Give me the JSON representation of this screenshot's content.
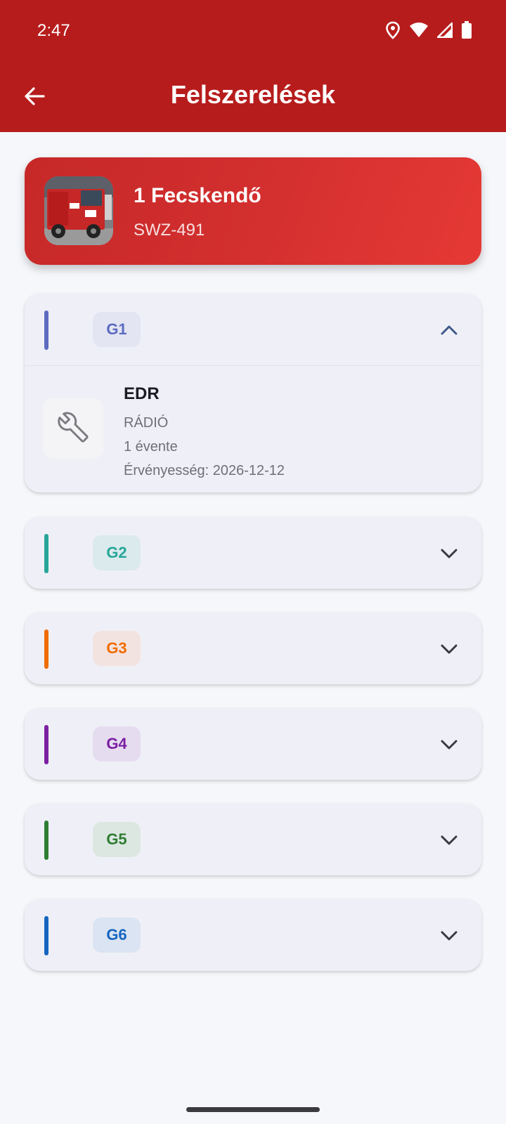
{
  "status_bar": {
    "time": "2:47",
    "icons": [
      "location-icon",
      "wifi-icon",
      "signal-icon",
      "battery-icon"
    ]
  },
  "app_bar": {
    "title": "Felszerelések",
    "back_icon": "back-arrow-icon"
  },
  "vehicle": {
    "name": "1 Fecskendő",
    "plate": "SWZ-491",
    "photo": "fire-truck-photo"
  },
  "groups": [
    {
      "label": "G1",
      "color": "#5c6bc0",
      "expanded": true,
      "items": [
        {
          "title": "EDR",
          "category": "RÁDIÓ",
          "frequency": "1 évente",
          "validity": "Érvényesség: 2026-12-12",
          "icon": "wrench-icon"
        }
      ]
    },
    {
      "label": "G2",
      "color": "#26a69a",
      "expanded": false
    },
    {
      "label": "G3",
      "color": "#ef6c00",
      "expanded": false
    },
    {
      "label": "G4",
      "color": "#7b1fa2",
      "expanded": false
    },
    {
      "label": "G5",
      "color": "#2e7d32",
      "expanded": false
    },
    {
      "label": "G6",
      "color": "#1565c0",
      "expanded": false
    }
  ],
  "colors": {
    "app_bar": "#b71c1c",
    "vehicle_card": "#d32f2f",
    "background": "#f6f7fb",
    "group_card": "#eff0f7"
  }
}
